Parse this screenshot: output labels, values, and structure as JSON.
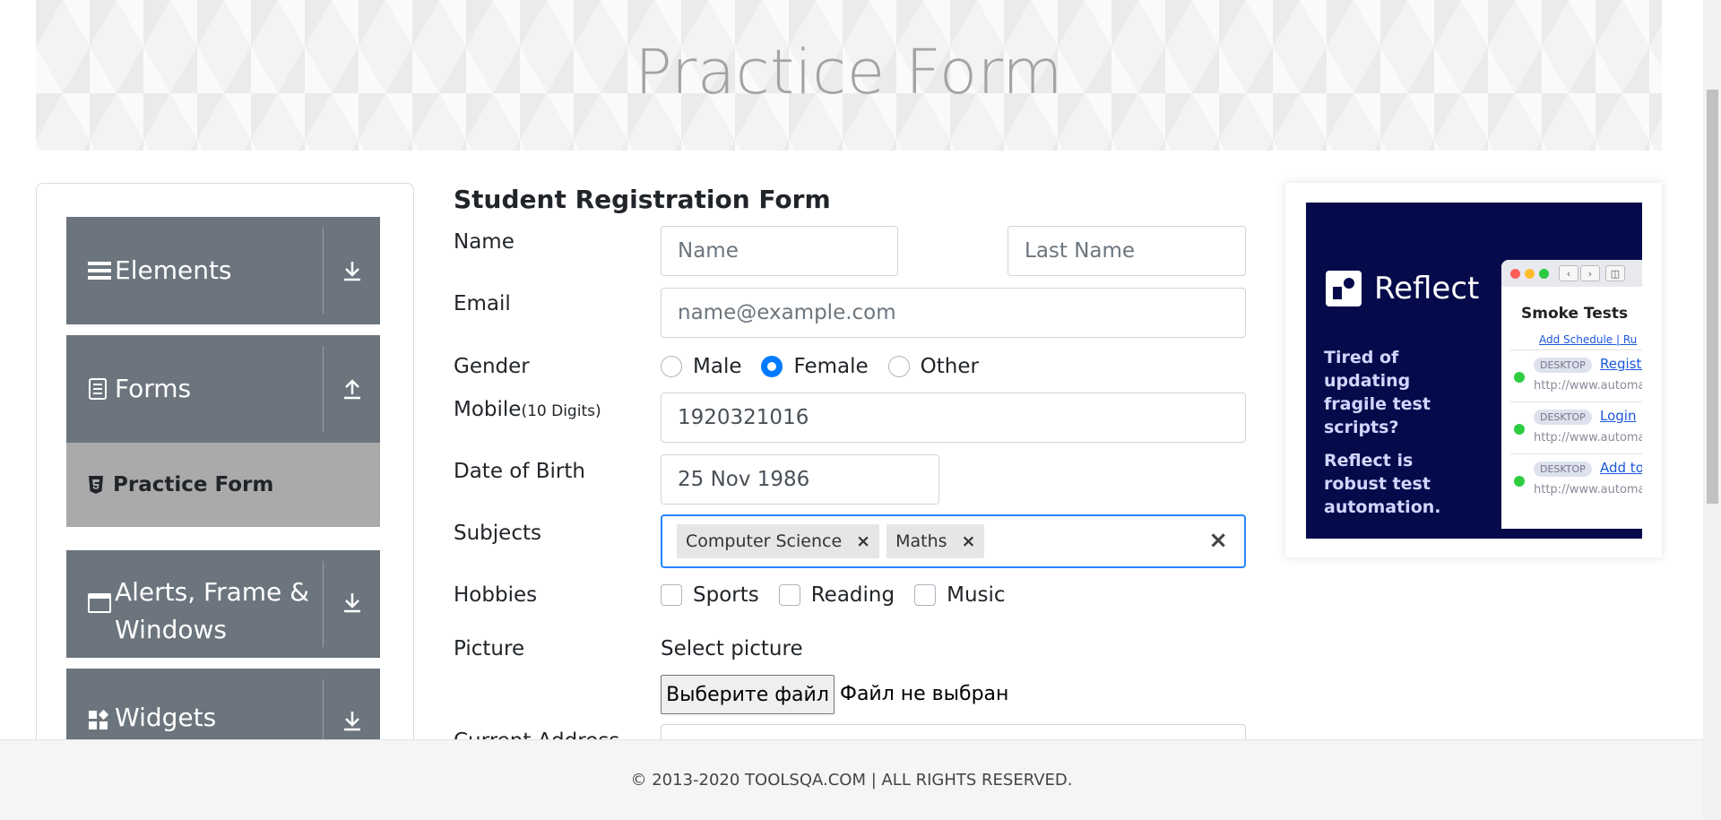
{
  "banner": {
    "title": "Practice Form"
  },
  "sidebar": {
    "groups": [
      {
        "label": "Elements",
        "icon": "menu-icon",
        "arrow": "download-arrow-icon"
      },
      {
        "label": "Forms",
        "icon": "document-icon",
        "arrow": "upload-arrow-icon"
      },
      {
        "label": "Alerts, Frame & Windows",
        "icon": "window-icon",
        "arrow": "download-arrow-icon"
      },
      {
        "label": "Widgets",
        "icon": "widgets-icon",
        "arrow": "download-arrow-icon"
      }
    ],
    "subitem": {
      "label": "Practice Form",
      "icon": "html5-icon"
    }
  },
  "form": {
    "title": "Student Registration Form",
    "name_label": "Name",
    "first_name_placeholder": "Name",
    "last_name_placeholder": "Last Name",
    "email_label": "Email",
    "email_placeholder": "name@example.com",
    "gender_label": "Gender",
    "gender_options": [
      "Male",
      "Female",
      "Other"
    ],
    "gender_selected": "Female",
    "mobile_label": "Mobile",
    "mobile_hint": "(10 Digits)",
    "mobile_value": "1920321016",
    "dob_label": "Date of Birth",
    "dob_value": "25 Nov 1986",
    "subjects_label": "Subjects",
    "subjects": [
      "Computer Science",
      "Maths"
    ],
    "subjects_clear": "×",
    "chip_remove": "×",
    "hobbies_label": "Hobbies",
    "hobbies": [
      "Sports",
      "Reading",
      "Music"
    ],
    "picture_label": "Picture",
    "picture_caption": "Select picture",
    "file_button": "Выберите файл",
    "file_status": "Файл не выбран",
    "current_address_label": "Current Address"
  },
  "ad": {
    "brand": "Reflect",
    "text1": "Tired of updating fragile test scripts?",
    "text2": "Reflect is robust test automation.",
    "window_title": "Smoke Tests",
    "schedule": "Add Schedule | Ru",
    "rows": [
      {
        "badge": "DESKTOP",
        "link": "Registr",
        "url": "http://www.automat"
      },
      {
        "badge": "DESKTOP",
        "link": "Login",
        "url": "http://www.automat"
      },
      {
        "badge": "DESKTOP",
        "link": "Add to",
        "url": "http://www.automat"
      }
    ]
  },
  "footer": {
    "text": "© 2013-2020 TOOLSQA.COM | ALL RIGHTS RESERVED."
  },
  "colors": {
    "accent": "#007bff",
    "nav": "#6c757d",
    "active_nav": "#aaaaaa",
    "ad_bg": "#050a4a",
    "focus": "#2684ff"
  }
}
